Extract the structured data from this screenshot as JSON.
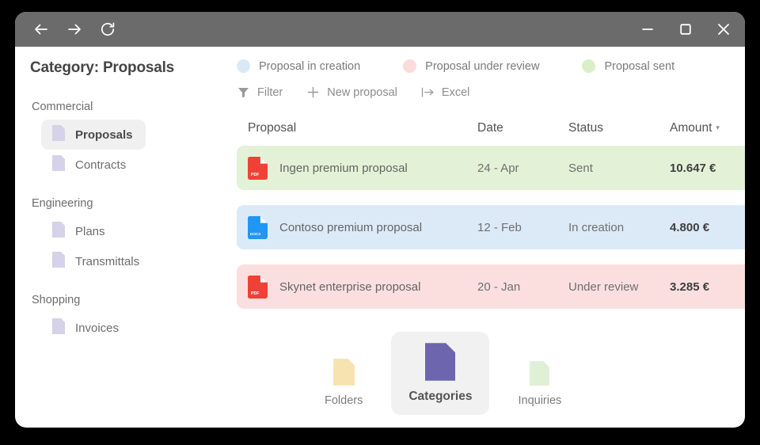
{
  "titlebar": {
    "back_icon": "arrow-left-icon",
    "forward_icon": "arrow-right-icon",
    "reload_icon": "reload-icon",
    "minimize_icon": "minimize-icon",
    "maximize_icon": "maximize-icon",
    "close_icon": "close-icon"
  },
  "page": {
    "title": "Category: Proposals"
  },
  "sidebar": {
    "groups": [
      {
        "label": "Commercial",
        "items": [
          {
            "label": "Proposals",
            "active": true
          },
          {
            "label": "Contracts",
            "active": false
          }
        ]
      },
      {
        "label": "Engineering",
        "items": [
          {
            "label": "Plans",
            "active": false
          },
          {
            "label": "Transmittals",
            "active": false
          }
        ]
      },
      {
        "label": "Shopping",
        "items": [
          {
            "label": "Invoices",
            "active": false
          }
        ]
      }
    ]
  },
  "legend": [
    {
      "label": "Proposal in creation",
      "color": "#dbe9f7"
    },
    {
      "label": "Proposal under review",
      "color": "#fbdcdc"
    },
    {
      "label": "Proposal sent",
      "color": "#d9f0c7"
    }
  ],
  "toolbar": [
    {
      "label": "Filter",
      "icon": "filter-icon"
    },
    {
      "label": "New proposal",
      "icon": "plus-icon"
    },
    {
      "label": "Excel",
      "icon": "export-icon"
    }
  ],
  "table": {
    "columns": {
      "proposal": "Proposal",
      "date": "Date",
      "status": "Status",
      "amount": "Amount",
      "sort_caret": "▾"
    },
    "rows": [
      {
        "name": "Ingen premium proposal",
        "date": "24 - Apr",
        "status": "Sent",
        "amount": "10.647 €",
        "file_type": "PDF",
        "file_color": "#ef4136",
        "row_color": "#e3f2d6"
      },
      {
        "name": "Contoso premium proposal",
        "date": "12 - Feb",
        "status": "In creation",
        "amount": "4.800 €",
        "file_type": "DOCX",
        "file_color": "#2196f3",
        "row_color": "#dceaf8"
      },
      {
        "name": "Skynet enterprise proposal",
        "date": "20 - Jan",
        "status": "Under review",
        "amount": "3.285 €",
        "file_type": "PDF",
        "file_color": "#ef4136",
        "row_color": "#fbdfdf"
      }
    ]
  },
  "bottom_nav": [
    {
      "label": "Folders",
      "color": "#f7e3b0",
      "active": false
    },
    {
      "label": "Categories",
      "color": "#6d65ad",
      "active": true
    },
    {
      "label": "Inquiries",
      "color": "#e0f0d6",
      "active": false
    }
  ]
}
